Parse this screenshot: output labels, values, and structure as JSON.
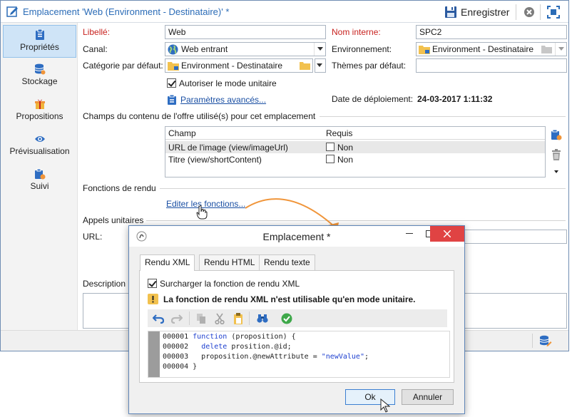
{
  "window": {
    "title": "Emplacement 'Web (Environment - Destinataire)' *",
    "save_label": "Enregistrer"
  },
  "sidebar": {
    "items": [
      {
        "label": "Propriétés",
        "icon": "properties-icon",
        "active": true
      },
      {
        "label": "Stockage",
        "icon": "storage-icon"
      },
      {
        "label": "Propositions",
        "icon": "propositions-icon"
      },
      {
        "label": "Prévisualisation",
        "icon": "preview-icon"
      },
      {
        "label": "Suivi",
        "icon": "tracking-icon"
      }
    ]
  },
  "form": {
    "libelle_label": "Libellé:",
    "libelle_value": "Web",
    "nom_interne_label": "Nom interne:",
    "nom_interne_value": "SPC2",
    "canal_label": "Canal:",
    "canal_value": "Web entrant",
    "environnement_label": "Environnement:",
    "environnement_value": "Environment - Destinataire",
    "categorie_label": "Catégorie par défaut:",
    "categorie_value": "Environment - Destinataire",
    "themes_label": "Thèmes par défaut:",
    "themes_value": "",
    "autoriser_label": "Autoriser le mode unitaire",
    "autoriser_checked": true,
    "parametres_link": "Paramètres avancés...",
    "date_label": "Date de déploiement:",
    "date_value": "24-03-2017 1:11:32"
  },
  "champs": {
    "section_title": "Champs du contenu de l'offre utilisé(s) pour cet emplacement",
    "col_champ": "Champ",
    "col_requis": "Requis",
    "rows": [
      {
        "champ": "URL de l'image (view/imageUrl)",
        "requis": "Non"
      },
      {
        "champ": "Titre (view/shortContent)",
        "requis": "Non"
      }
    ]
  },
  "rendu": {
    "section_title": "Fonctions de rendu",
    "edit_link": "Editer les fonctions..."
  },
  "appels": {
    "section_title": "Appels unitaires",
    "url_label": "URL:"
  },
  "description": {
    "label": "Description"
  },
  "dialog": {
    "title": "Emplacement *",
    "tabs": [
      "Rendu XML",
      "Rendu HTML",
      "Rendu texte"
    ],
    "surcharger_label": "Surcharger la fonction de rendu XML",
    "surcharger_checked": true,
    "warning": "La fonction de rendu XML n'est utilisable qu'en mode unitaire.",
    "code_lines": [
      {
        "num": "000001",
        "code": "function (proposition) {"
      },
      {
        "num": "000002",
        "code": "  delete prosition.@id;"
      },
      {
        "num": "000003",
        "code": "  proposition.@newAttribute = \"newValue\";"
      },
      {
        "num": "000004",
        "code": "}"
      }
    ],
    "ok_label": "Ok",
    "cancel_label": "Annuler"
  },
  "colors": {
    "accent": "#2b6cb7",
    "required_label": "#c8221f",
    "nav_active": "#cfe4f7",
    "close_button": "#e04343",
    "arrow": "#f0953a",
    "link": "#1a4fa3"
  }
}
